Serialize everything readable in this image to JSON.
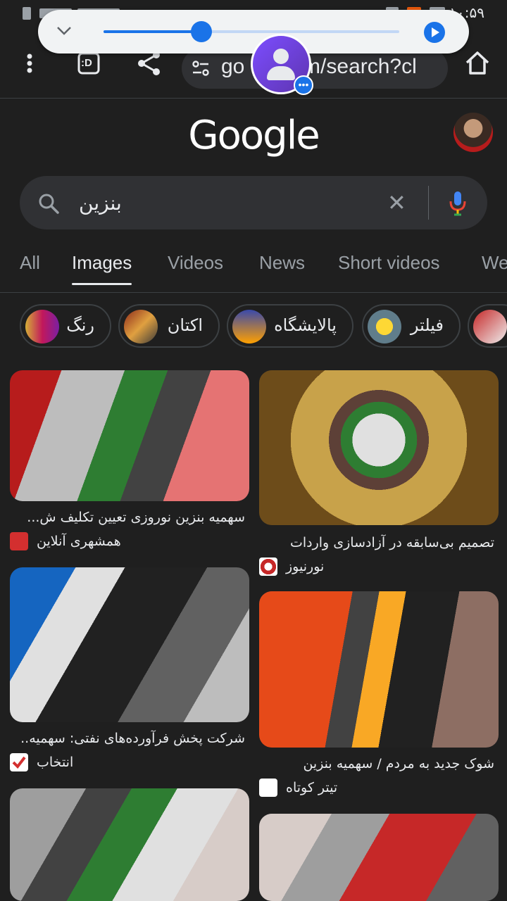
{
  "status_bar": {
    "time": "۱۰:۵۹"
  },
  "media": {
    "progress": 0.33
  },
  "toolbar": {
    "menu_icon": "more-vert-icon",
    "tab_switcher_label": ":D",
    "share_icon": "share-icon",
    "url": "google.com/search?cl",
    "url_visible": "go",
    "url_tail": "om/search?cl"
  },
  "page": {
    "logo": "Google",
    "search_query": "بنزین",
    "tabs": [
      "All",
      "Images",
      "Videos",
      "News",
      "Short videos",
      "We"
    ],
    "active_tab": "Images",
    "chips": [
      "رنگ",
      "اکتان",
      "پالایشگاه",
      "فیلتر"
    ]
  },
  "results": [
    {
      "title": "سهمیه بنزین نوروزی تعیین تکلیف ش...",
      "source": "همشهری آنلاین"
    },
    {
      "title": "تصمیم بی‌سابقه در آزادسازی واردات",
      "source": "نورنیوز"
    },
    {
      "title": "شرکت پخش فرآورده‌های نفتی: سهمیه..",
      "source": "انتخاب"
    },
    {
      "title": "شوک جدید به مردم / سهمیه بنزین",
      "source": "تیتر کوتاه"
    }
  ],
  "colors": {
    "accent": "#1a73e8",
    "background": "#1f1f1f",
    "surface": "#303134"
  }
}
